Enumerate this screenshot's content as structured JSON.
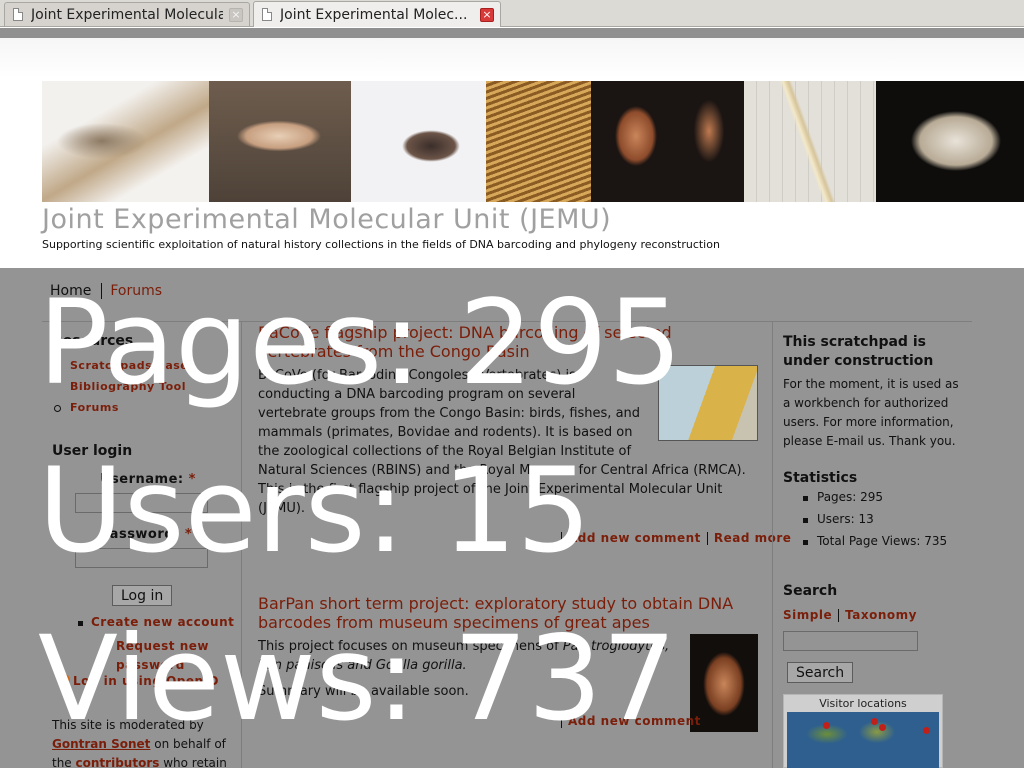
{
  "browser": {
    "tabs": [
      {
        "label": "Joint Experimental Molecular...",
        "active": false
      },
      {
        "label": "Joint Experimental Molec...",
        "active": true
      }
    ],
    "close_glyph": "×"
  },
  "header": {
    "title": "Joint Experimental Molecular Unit (JEMU)",
    "slogan": "Supporting scientific exploitation of natural history collections in the fields of DNA barcoding and phylogeny reconstruction"
  },
  "nav": {
    "items": [
      {
        "label": "Home"
      },
      {
        "label": "Forums"
      }
    ]
  },
  "left_sidebar": {
    "resources_title": "Resources",
    "resources": [
      {
        "label": "Scratchpads Base"
      },
      {
        "label": "Bibliography Tool"
      },
      {
        "label": "Forums"
      }
    ],
    "login": {
      "title": "User login",
      "username_label": "Username:",
      "password_label": "Password:",
      "required_mark": "*",
      "button": "Log in",
      "create_account": "Create new account",
      "request_password": "Request new password",
      "openid": "Log in using OpenID"
    },
    "moderation": {
      "line1": "This site is moderated by",
      "moderator": "Gontran Sonet",
      "line2": "on behalf of",
      "line3": "the",
      "contributors": "contributors",
      "line4": "who retain"
    }
  },
  "main": {
    "nodes": [
      {
        "title_line1": "BaCoVe flagship project: DNA barcoding of selected",
        "title_line2": "vertebrates from the Congo Basin",
        "body": [
          "BaCoVe (for Barcoding Congolese Vertebrates) is",
          "conducting a DNA barcoding program on several",
          "vertebrate groups from the Congo Basin: birds, fishes, and",
          "mammals (primates, Bovidae and rodents). It is based on",
          "the zoological collections of the Royal Belgian Institute of",
          "Natural Sciences (RBINS) and the Royal Museum for Central Africa (RMCA).",
          "This is the first flagship project of the Joint Experimental Molecular Unit",
          "(JEMU)."
        ],
        "links": [
          "Add new comment",
          "Read more"
        ]
      },
      {
        "title_line1": "BarPan short term project: exploratory study to obtain DNA",
        "title_line2": "barcodes from museum specimens of great apes",
        "body_line1_a": "This project focuses on museum specimens of ",
        "body_line1_b": "Pan troglodytes,",
        "body_line2": "Pan paniscus and Gorilla gorilla.",
        "body_line3": "Summary will be available soon.",
        "links": [
          "Add new comment"
        ]
      }
    ]
  },
  "right_sidebar": {
    "construction_title_1": "This scratchpad is",
    "construction_title_2": "under construction",
    "construction_text": "For the moment, it is used as a workbench for authorized users. For more information, please E-mail us. Thank you.",
    "statistics_title": "Statistics",
    "statistics": [
      {
        "label": "Pages: 295"
      },
      {
        "label": "Users: 13"
      },
      {
        "label": "Total Page Views: 735"
      }
    ],
    "search_title": "Search",
    "search_links": [
      "Simple",
      "Taxonomy"
    ],
    "search_button": "Search",
    "map_title": "Visitor locations"
  },
  "overlay": {
    "pages": "Pages: 295",
    "users": "Users: 15",
    "views": "Views: 737",
    "color": "#ffffff"
  },
  "colors": {
    "link": "#7a1e0a",
    "body_bg": "#949494",
    "title_gray": "#a0a0a0"
  }
}
